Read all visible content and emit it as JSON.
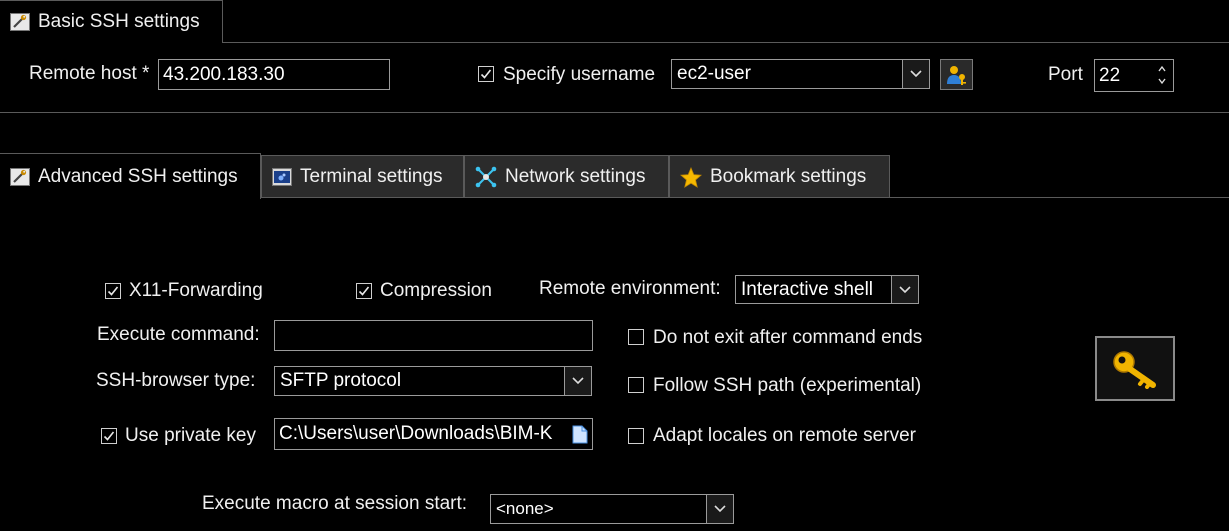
{
  "basic_tab": {
    "label": "Basic SSH settings",
    "icon": "wrench-icon"
  },
  "basic": {
    "remote_host_label": "Remote host *",
    "remote_host_value": "43.200.183.30",
    "specify_username_label": "Specify username",
    "specify_username_checked": true,
    "username_value": "ec2-user",
    "port_label": "Port",
    "port_value": "22"
  },
  "tabs": [
    {
      "label": "Advanced SSH settings",
      "icon": "wrench-icon",
      "active": true
    },
    {
      "label": "Terminal settings",
      "icon": "terminal-icon",
      "active": false
    },
    {
      "label": "Network settings",
      "icon": "network-icon",
      "active": false
    },
    {
      "label": "Bookmark settings",
      "icon": "star-icon",
      "active": false
    }
  ],
  "advanced": {
    "x11_label": "X11-Forwarding",
    "x11_checked": true,
    "compression_label": "Compression",
    "compression_checked": true,
    "remote_env_label": "Remote environment:",
    "remote_env_value": "Interactive shell",
    "execute_command_label": "Execute command:",
    "execute_command_value": "",
    "do_not_exit_label": "Do not exit after command ends",
    "do_not_exit_checked": false,
    "ssh_browser_label": "SSH-browser type:",
    "ssh_browser_value": "SFTP protocol",
    "follow_path_label": "Follow SSH path (experimental)",
    "follow_path_checked": false,
    "private_key_label": "Use private key",
    "private_key_checked": true,
    "private_key_value": "C:\\Users\\user\\Downloads\\BIM-K",
    "adapt_locales_label": "Adapt locales on remote server",
    "adapt_locales_checked": false,
    "macro_label": "Execute macro at session start:",
    "macro_value": "<none>"
  },
  "colors": {
    "background": "#000000",
    "border": "#9a9a9a",
    "key_icon": "#f0b400"
  }
}
